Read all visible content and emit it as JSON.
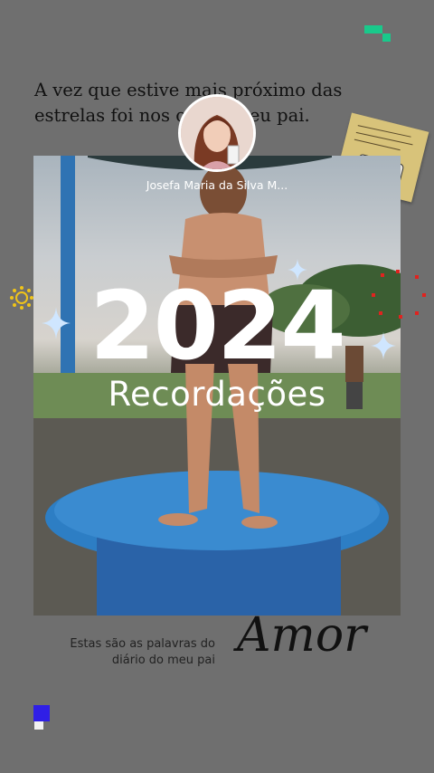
{
  "quote": {
    "line1": "A vez que estive mais próximo das",
    "line2": "estrelas foi nos o… … meu pai."
  },
  "story": {
    "author_name": "Josefa Maria da Silva M...",
    "title_year": "2024",
    "title_subtitle": "Recordações"
  },
  "caption": {
    "line1": "Estas são as palavras do",
    "line2": "diário do meu pai"
  },
  "signature": "Amor",
  "colors": {
    "background": "#6f6f6f",
    "accent_green": "#19c98b",
    "accent_blue": "#2f1fe6",
    "pool_blue": "#2e7cc1",
    "red_dots": "#e0231f"
  }
}
